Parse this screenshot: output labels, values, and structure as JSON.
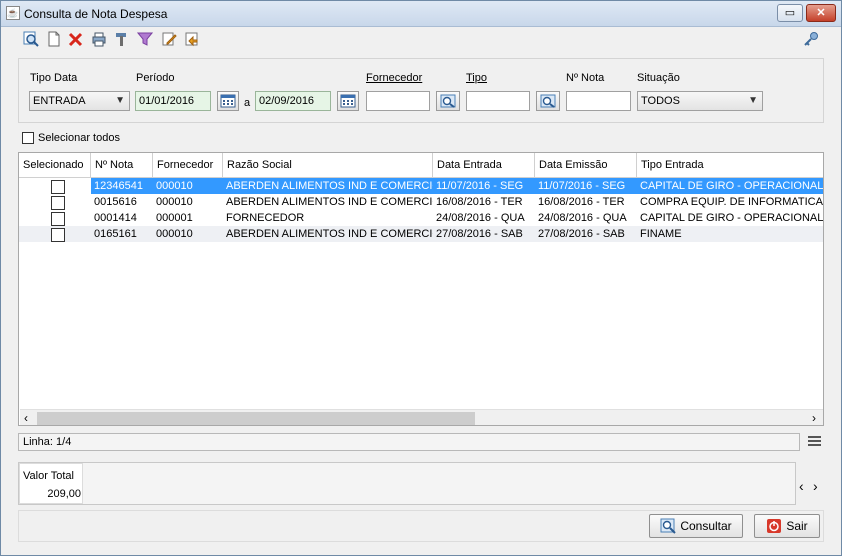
{
  "window": {
    "title": "Consulta de Nota Despesa"
  },
  "toolbar": {
    "icons": [
      "search-icon",
      "new-document-icon",
      "delete-icon",
      "print-icon",
      "tools-icon",
      "filter-icon",
      "edit-icon",
      "export-icon",
      "key-icon"
    ]
  },
  "filters": {
    "tipo_data_label": "Tipo Data",
    "tipo_data_value": "ENTRADA",
    "periodo_label": "Período",
    "periodo_from": "01/01/2016",
    "periodo_sep": "a",
    "periodo_to": "02/09/2016",
    "fornecedor_label": "Fornecedor",
    "fornecedor_value": "",
    "tipo_label": "Tipo",
    "tipo_value": "",
    "nota_label": "Nº Nota",
    "nota_value": "",
    "situacao_label": "Situação",
    "situacao_value": "TODOS"
  },
  "select_all_label": "Selecionar todos",
  "table": {
    "columns": [
      "Selecionado",
      "Nº Nota",
      "Fornecedor",
      "Razão Social",
      "Data Entrada",
      "Data Emissão",
      "Tipo Entrada"
    ],
    "rows": [
      {
        "nota": "12346541",
        "fornecedor": "000010",
        "razao": "ABERDEN ALIMENTOS IND E COMERCIO",
        "entrada": "11/07/2016 - SEG",
        "emissao": "11/07/2016 - SEG",
        "tipo": "CAPITAL DE GIRO - OPERACIONAL",
        "selected": true
      },
      {
        "nota": "0015616",
        "fornecedor": "000010",
        "razao": "ABERDEN ALIMENTOS IND E COMERCIO",
        "entrada": "16/08/2016 - TER",
        "emissao": "16/08/2016 - TER",
        "tipo": "COMPRA EQUIP. DE INFORMATICA",
        "selected": false
      },
      {
        "nota": "0001414",
        "fornecedor": "000001",
        "razao": "FORNECEDOR",
        "entrada": "24/08/2016 - QUA",
        "emissao": "24/08/2016 - QUA",
        "tipo": "CAPITAL DE GIRO - OPERACIONAL",
        "selected": false
      },
      {
        "nota": "0165161",
        "fornecedor": "000010",
        "razao": "ABERDEN ALIMENTOS IND E COMERCIO",
        "entrada": "27/08/2016 - SAB",
        "emissao": "27/08/2016 - SAB",
        "tipo": "FINAME",
        "selected": false
      }
    ]
  },
  "status": {
    "linha": "Linha: 1/4"
  },
  "total": {
    "label": "Valor Total",
    "value": "209,00"
  },
  "buttons": {
    "consultar": "Consultar",
    "sair": "Sair"
  },
  "colors": {
    "selection": "#3399ff",
    "alt_row": "#eef0f4"
  }
}
